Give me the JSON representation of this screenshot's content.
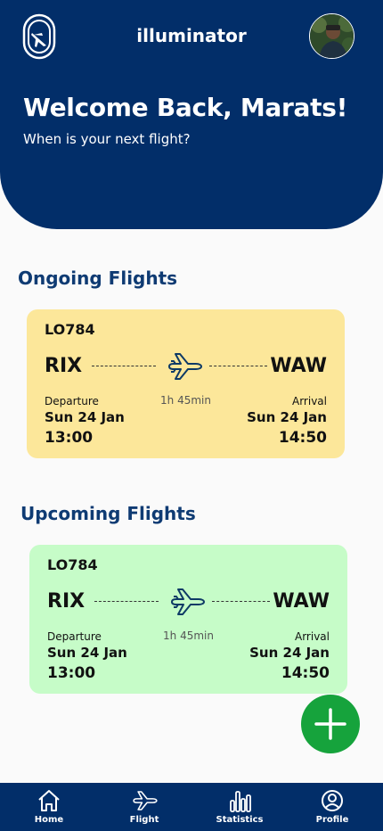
{
  "app": {
    "title": "illuminator"
  },
  "header": {
    "welcome": "Welcome Back, Marats!",
    "subtitle": "When is your next flight?",
    "background": "#022e69"
  },
  "sections": {
    "ongoing_title": "Ongoing Flights",
    "upcoming_title": "Upcoming Flights"
  },
  "ongoing": {
    "code": "LO784",
    "from": "RIX",
    "to": "WAW",
    "duration": "1h 45min",
    "departure_label": "Departure",
    "arrival_label": "Arrival",
    "departure_date": "Sun 24 Jan",
    "arrival_date": "Sun 24 Jan",
    "departure_time": "13:00",
    "arrival_time": "14:50",
    "color": "#fce79a"
  },
  "upcoming": {
    "code": "LO784",
    "from": "RIX",
    "to": "WAW",
    "duration": "1h 45min",
    "departure_label": "Departure",
    "arrival_label": "Arrival",
    "departure_date": "Sun 24 Jan",
    "arrival_date": "Sun 24 Jan",
    "departure_time": "13:00",
    "arrival_time": "14:50",
    "color": "#c6fcc8"
  },
  "fab": {
    "icon": "plus-icon",
    "color": "#16a33c"
  },
  "nav": {
    "items": [
      {
        "label": "Home",
        "icon": "home-icon"
      },
      {
        "label": "Flight",
        "icon": "plane-icon"
      },
      {
        "label": "Statistics",
        "icon": "bar-chart-icon"
      },
      {
        "label": "Profile",
        "icon": "user-icon"
      }
    ]
  }
}
